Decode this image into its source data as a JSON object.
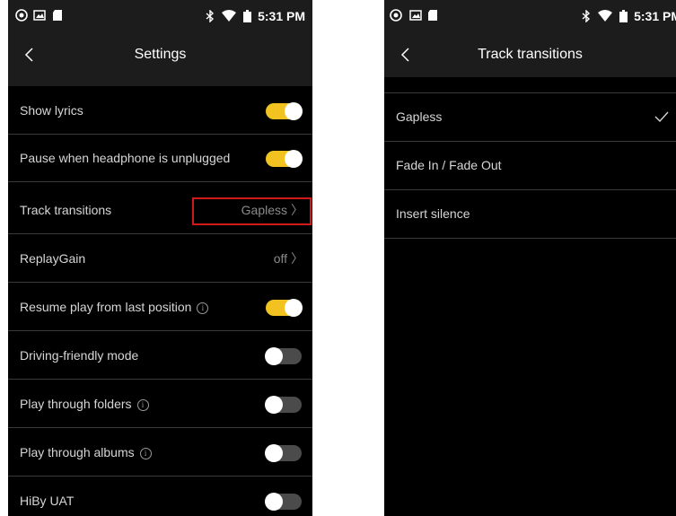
{
  "left_screen": {
    "status": {
      "time": "5:31 PM",
      "icons": [
        "app-icon",
        "image-icon",
        "sd-card-icon",
        "bluetooth-icon",
        "wifi-icon",
        "battery-icon"
      ]
    },
    "title": "Settings",
    "rows": [
      {
        "label": "Show lyrics",
        "toggle": "on"
      },
      {
        "label": "Pause when headphone is unplugged",
        "toggle": "on"
      },
      {
        "label": "Track transitions",
        "value": "Gapless"
      },
      {
        "label": "ReplayGain",
        "value": "off"
      },
      {
        "label": "Resume play from last position",
        "info": true,
        "toggle": "on"
      },
      {
        "label": "Driving-friendly mode",
        "toggle": "off"
      },
      {
        "label": "Play through folders",
        "info": true,
        "toggle": "off"
      },
      {
        "label": "Play through albums",
        "info": true,
        "toggle": "off"
      },
      {
        "label": "HiBy UAT",
        "toggle": "off"
      }
    ]
  },
  "right_screen": {
    "status": {
      "time": "5:31 PM"
    },
    "title": "Track transitions",
    "options": [
      {
        "label": "Gapless",
        "selected": true
      },
      {
        "label": "Fade In / Fade Out",
        "selected": false
      },
      {
        "label": "Insert silence",
        "selected": false
      }
    ]
  },
  "colors": {
    "accent": "#f2c320",
    "bar": "#1c1c1c",
    "background": "#000000",
    "highlight_box": "#d01a1a"
  }
}
